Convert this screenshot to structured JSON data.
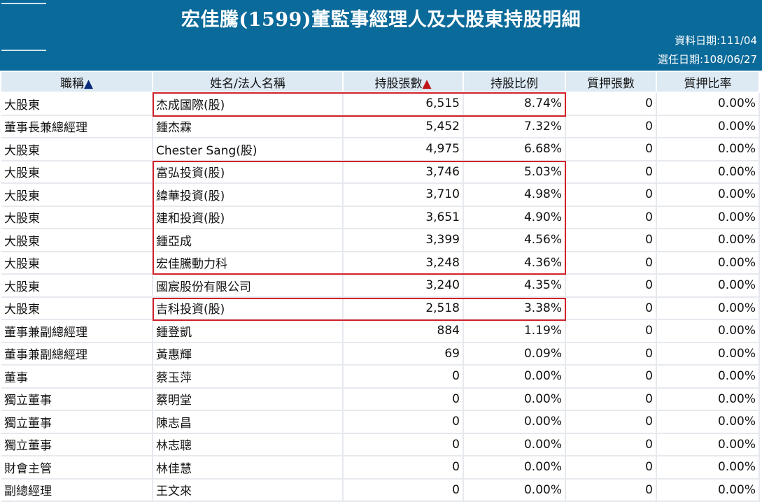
{
  "page": {
    "title": "宏佳騰(1599)董監事經理人及大股東持股明細",
    "data_date": "資料日期:111/04",
    "elect_date": "選任日期:108/06/27"
  },
  "columns": [
    {
      "label": "職稱",
      "sort": "▲"
    },
    {
      "label": "姓名/法人名稱",
      "sort": ""
    },
    {
      "label": "持股張數",
      "sort": "▲"
    },
    {
      "label": "持股比例",
      "sort": ""
    },
    {
      "label": "質押張數",
      "sort": ""
    },
    {
      "label": "質押比率",
      "sort": ""
    }
  ],
  "rows": [
    {
      "title": "大股東",
      "name": "杰成國際(股)",
      "shares": "6,515",
      "ratio": "8.74%",
      "pledge": "0",
      "pledge_ratio": "0.00%"
    },
    {
      "title": "董事長兼總經理",
      "name": "鍾杰霖",
      "shares": "5,452",
      "ratio": "7.32%",
      "pledge": "0",
      "pledge_ratio": "0.00%"
    },
    {
      "title": "大股東",
      "name": "Chester Sang(股)",
      "shares": "4,975",
      "ratio": "6.68%",
      "pledge": "0",
      "pledge_ratio": "0.00%"
    },
    {
      "title": "大股東",
      "name": "富弘投資(股)",
      "shares": "3,746",
      "ratio": "5.03%",
      "pledge": "0",
      "pledge_ratio": "0.00%"
    },
    {
      "title": "大股東",
      "name": "緯華投資(股)",
      "shares": "3,710",
      "ratio": "4.98%",
      "pledge": "0",
      "pledge_ratio": "0.00%"
    },
    {
      "title": "大股東",
      "name": "建和投資(股)",
      "shares": "3,651",
      "ratio": "4.90%",
      "pledge": "0",
      "pledge_ratio": "0.00%"
    },
    {
      "title": "大股東",
      "name": "鍾亞成",
      "shares": "3,399",
      "ratio": "4.56%",
      "pledge": "0",
      "pledge_ratio": "0.00%"
    },
    {
      "title": "大股東",
      "name": "宏佳騰動力科",
      "shares": "3,248",
      "ratio": "4.36%",
      "pledge": "0",
      "pledge_ratio": "0.00%"
    },
    {
      "title": "大股東",
      "name": "國宸股份有限公司",
      "shares": "3,240",
      "ratio": "4.35%",
      "pledge": "0",
      "pledge_ratio": "0.00%"
    },
    {
      "title": "大股東",
      "name": "吉科投資(股)",
      "shares": "2,518",
      "ratio": "3.38%",
      "pledge": "0",
      "pledge_ratio": "0.00%"
    },
    {
      "title": "董事兼副總經理",
      "name": "鍾登凱",
      "shares": "884",
      "ratio": "1.19%",
      "pledge": "0",
      "pledge_ratio": "0.00%"
    },
    {
      "title": "董事兼副總經理",
      "name": "黃惠輝",
      "shares": "69",
      "ratio": "0.09%",
      "pledge": "0",
      "pledge_ratio": "0.00%"
    },
    {
      "title": "董事",
      "name": "蔡玉萍",
      "shares": "0",
      "ratio": "0.00%",
      "pledge": "0",
      "pledge_ratio": "0.00%"
    },
    {
      "title": "獨立董事",
      "name": "蔡明堂",
      "shares": "0",
      "ratio": "0.00%",
      "pledge": "0",
      "pledge_ratio": "0.00%"
    },
    {
      "title": "獨立董事",
      "name": "陳志昌",
      "shares": "0",
      "ratio": "0.00%",
      "pledge": "0",
      "pledge_ratio": "0.00%"
    },
    {
      "title": "獨立董事",
      "name": "林志聰",
      "shares": "0",
      "ratio": "0.00%",
      "pledge": "0",
      "pledge_ratio": "0.00%"
    },
    {
      "title": "財會主管",
      "name": "林佳慧",
      "shares": "0",
      "ratio": "0.00%",
      "pledge": "0",
      "pledge_ratio": "0.00%"
    },
    {
      "title": "副總經理",
      "name": "王文來",
      "shares": "0",
      "ratio": "0.00%",
      "pledge": "0",
      "pledge_ratio": "0.00%"
    }
  ],
  "colors": {
    "header_bg": "#0a6a9a",
    "column_header_bg": "#ddeaf4",
    "highlight_border": "#d2222a",
    "sort_up_blue": "#0a2a7a",
    "sort_up_red": "#c2151a"
  }
}
